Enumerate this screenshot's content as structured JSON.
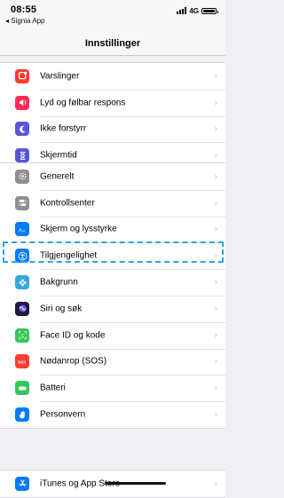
{
  "status": {
    "time": "08:55",
    "back_app": "◂ Signia App",
    "network": "4G"
  },
  "nav": {
    "title": "Innstillinger"
  },
  "groups": {
    "g1": [
      {
        "label": "Varslinger",
        "icon": "notifications-icon",
        "color": "#ff3b30"
      },
      {
        "label": "Lyd og følbar respons",
        "icon": "sound-icon",
        "color": "#ff2d55"
      },
      {
        "label": "Ikke forstyrr",
        "icon": "moon-icon",
        "color": "#5856d6"
      },
      {
        "label": "Skjermtid",
        "icon": "hourglass-icon",
        "color": "#5856d6"
      }
    ],
    "g2": [
      {
        "label": "Generelt",
        "icon": "gear-icon",
        "color": "#8e8e93"
      },
      {
        "label": "Kontrollsenter",
        "icon": "toggles-icon",
        "color": "#8e8e93"
      },
      {
        "label": "Skjerm og lysstyrke",
        "icon": "text-size-icon",
        "color": "#007aff"
      },
      {
        "label": "Tilgjengelighet",
        "icon": "accessibility-icon",
        "color": "#007aff"
      },
      {
        "label": "Bakgrunn",
        "icon": "flower-icon",
        "color": "#34aadc"
      },
      {
        "label": "Siri og søk",
        "icon": "siri-icon",
        "color": "#1c1c3c"
      },
      {
        "label": "Face ID og kode",
        "icon": "face-id-icon",
        "color": "#34c759"
      },
      {
        "label": "Nødanrop (SOS)",
        "icon": "sos-icon",
        "color": "#ff3b30"
      },
      {
        "label": "Batteri",
        "icon": "battery-icon",
        "color": "#34c759"
      },
      {
        "label": "Personvern",
        "icon": "hand-icon",
        "color": "#007aff"
      }
    ],
    "g3": [
      {
        "label": "iTunes og App Store",
        "icon": "app-store-icon",
        "color": "#007aff"
      }
    ]
  },
  "chevron": "›"
}
